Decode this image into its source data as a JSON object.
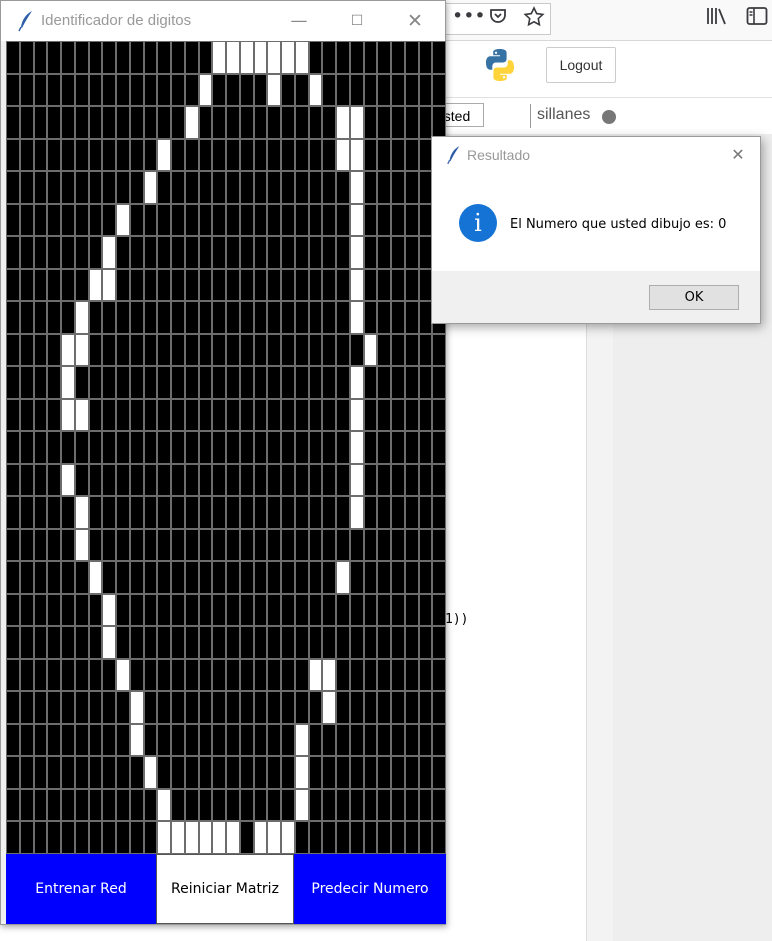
{
  "browser": {
    "toolbar_icons": [
      "more-icon",
      "pocket-icon",
      "bookmark-star-icon",
      "library-icon",
      "sidebar-icon"
    ]
  },
  "jupyter": {
    "logout_label": "Logout",
    "name_fragment": "usted",
    "user": "sillanes",
    "code_fragment": "1))"
  },
  "main_window": {
    "title": "Identificador de digitos",
    "columns": 32,
    "rows": 25,
    "pixels_on": [
      [
        0,
        15
      ],
      [
        0,
        16
      ],
      [
        0,
        17
      ],
      [
        0,
        18
      ],
      [
        0,
        19
      ],
      [
        0,
        20
      ],
      [
        0,
        21
      ],
      [
        1,
        14
      ],
      [
        1,
        19
      ],
      [
        1,
        22
      ],
      [
        2,
        13
      ],
      [
        2,
        24
      ],
      [
        2,
        25
      ],
      [
        3,
        11
      ],
      [
        3,
        24
      ],
      [
        3,
        25
      ],
      [
        4,
        10
      ],
      [
        4,
        25
      ],
      [
        5,
        8
      ],
      [
        5,
        25
      ],
      [
        6,
        7
      ],
      [
        6,
        25
      ],
      [
        7,
        6
      ],
      [
        7,
        7
      ],
      [
        7,
        25
      ],
      [
        8,
        5
      ],
      [
        8,
        25
      ],
      [
        9,
        4
      ],
      [
        9,
        5
      ],
      [
        9,
        26
      ],
      [
        10,
        4
      ],
      [
        10,
        25
      ],
      [
        11,
        4
      ],
      [
        11,
        5
      ],
      [
        11,
        25
      ],
      [
        12,
        25
      ],
      [
        13,
        4
      ],
      [
        13,
        25
      ],
      [
        14,
        5
      ],
      [
        14,
        25
      ],
      [
        15,
        5
      ],
      [
        16,
        6
      ],
      [
        16,
        24
      ],
      [
        17,
        7
      ],
      [
        18,
        7
      ],
      [
        19,
        8
      ],
      [
        19,
        22
      ],
      [
        19,
        23
      ],
      [
        20,
        9
      ],
      [
        20,
        23
      ],
      [
        21,
        9
      ],
      [
        21,
        21
      ],
      [
        22,
        10
      ],
      [
        22,
        21
      ],
      [
        23,
        11
      ],
      [
        23,
        21
      ],
      [
        24,
        11
      ],
      [
        24,
        12
      ],
      [
        24,
        13
      ],
      [
        24,
        14
      ],
      [
        24,
        15
      ],
      [
        24,
        16
      ],
      [
        24,
        18
      ],
      [
        24,
        19
      ],
      [
        24,
        20
      ]
    ],
    "buttons": {
      "train": "Entrenar Red",
      "reset": "Reiniciar Matriz",
      "predict": "Predecir Numero"
    }
  },
  "dialog": {
    "title": "Resultado",
    "message": "El Numero que usted dibujo es: 0",
    "ok_label": "OK"
  }
}
